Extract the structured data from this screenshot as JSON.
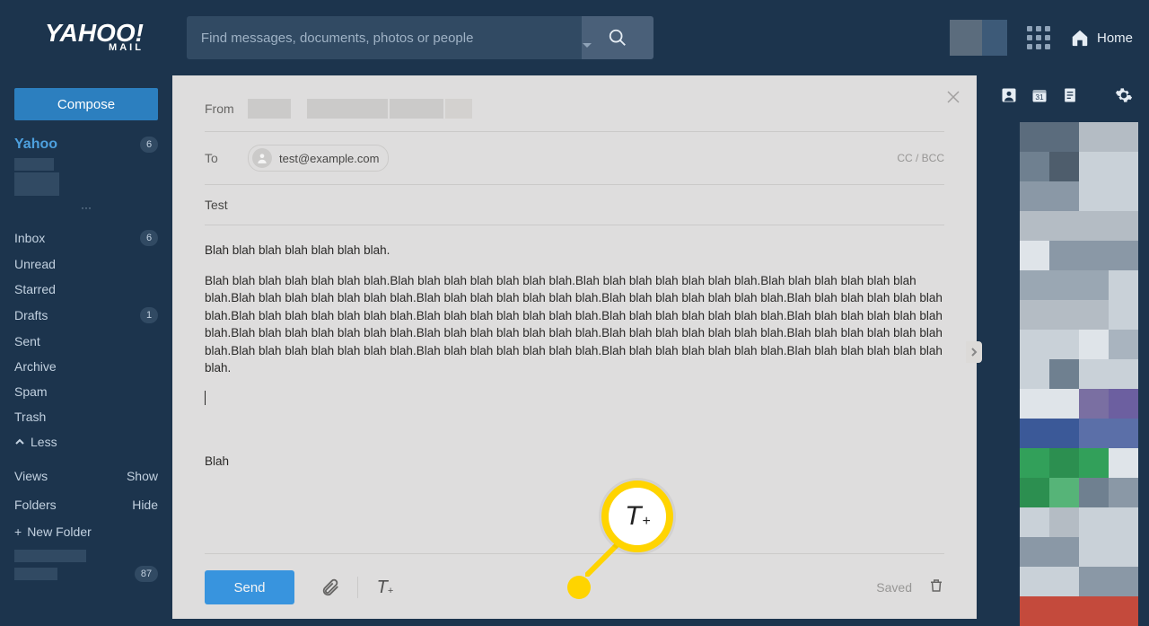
{
  "header": {
    "logo_top": "YAHOO!",
    "logo_bottom": "MAIL",
    "search_placeholder": "Find messages, documents, photos or people",
    "home": "Home"
  },
  "sidebar": {
    "compose": "Compose",
    "account_name": "Yahoo",
    "account_count": "6",
    "dots": "···",
    "folders": [
      {
        "label": "Inbox",
        "count": "6"
      },
      {
        "label": "Unread"
      },
      {
        "label": "Starred"
      },
      {
        "label": "Drafts",
        "count": "1"
      },
      {
        "label": "Sent"
      },
      {
        "label": "Archive"
      },
      {
        "label": "Spam"
      },
      {
        "label": "Trash"
      }
    ],
    "less": "Less",
    "views": "Views",
    "show": "Show",
    "folders_label": "Folders",
    "hide": "Hide",
    "new_folder": "New Folder",
    "extra_count": "87"
  },
  "compose": {
    "from_label": "From",
    "to_label": "To",
    "to_email": "test@example.com",
    "cc_bcc": "CC / BCC",
    "subject": "Test",
    "body_line1": "Blah blah blah blah blah blah blah.",
    "body_line2": "Blah blah blah blah blah blah blah.Blah blah blah blah blah blah blah.Blah blah blah blah blah blah blah.Blah blah blah blah blah blah blah.Blah blah blah blah blah blah blah.Blah blah blah blah blah blah blah.Blah blah blah blah blah blah blah.Blah blah blah blah blah blah blah.Blah blah blah blah blah blah blah.Blah blah blah blah blah blah blah.Blah blah blah blah blah blah blah.Blah blah blah blah blah blah blah.Blah blah blah blah blah blah blah.Blah blah blah blah blah blah blah.Blah blah blah blah blah blah blah.Blah blah blah blah blah blah blah.Blah blah blah blah blah blah blah.Blah blah blah blah blah blah blah.Blah blah blah blah blah blah blah.Blah blah blah blah blah blah blah.",
    "body_signature": "Blah",
    "send": "Send",
    "saved": "Saved",
    "format_icon_letter": "T",
    "format_icon_plus": "+"
  },
  "callout": {
    "letter": "T",
    "plus": "+"
  },
  "mosaic_colors": [
    "#5b6c7d",
    "#5b6c7d",
    "#b4bcc4",
    "#b4bcc4",
    "#6f8090",
    "#4e5d6c",
    "#c9d1d8",
    "#c9d1d8",
    "#8a98a6",
    "#8a98a6",
    "#c9d1d8",
    "#c9d1d8",
    "#b4bcc4",
    "#b4bcc4",
    "#b4bcc4",
    "#b4bcc4",
    "#dfe4e9",
    "#8a98a6",
    "#8a98a6",
    "#8a98a6",
    "#9aa7b3",
    "#9aa7b3",
    "#9aa7b3",
    "#c9d1d8",
    "#b4bcc4",
    "#b4bcc4",
    "#b4bcc4",
    "#c9d1d8",
    "#c9d1d8",
    "#c9d1d8",
    "#dfe4e9",
    "#a9b4bf",
    "#c9d1d8",
    "#6f8090",
    "#c9d1d8",
    "#c9d1d8",
    "#dfe4e9",
    "#dfe4e9",
    "#7a6fa2",
    "#6c5fa0",
    "#3b5998",
    "#3b5998",
    "#5b6fa8",
    "#5b6fa8",
    "#32a05a",
    "#2c8f50",
    "#32a05a",
    "#dfe4e9",
    "#2c8f50",
    "#56b478",
    "#6f8090",
    "#8a98a6",
    "#c9d1d8",
    "#b4bcc4",
    "#c9d1d8",
    "#c9d1d8",
    "#8a98a6",
    "#8a98a6",
    "#c9d1d8",
    "#c9d1d8",
    "#c9d1d8",
    "#c9d1d8",
    "#8a98a6",
    "#8a98a6",
    "#c44a3c",
    "#c44a3c",
    "#c44a3c",
    "#c44a3c"
  ]
}
